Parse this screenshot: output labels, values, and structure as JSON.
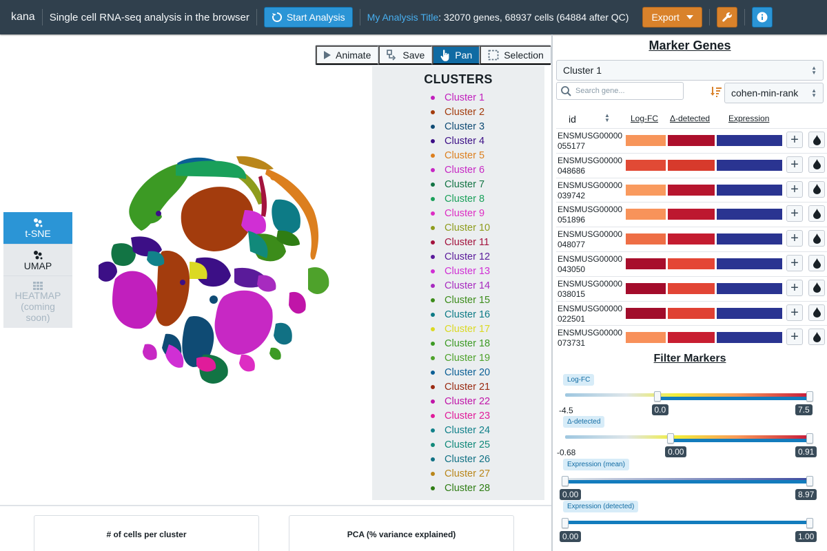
{
  "app": {
    "brand": "kana",
    "subtitle": "Single cell RNA-seq analysis in the browser",
    "start_button": "Start Analysis",
    "analysis_title": "My Analysis Title",
    "analysis_stats": ": 32070 genes, 68937 cells (64884 after QC)",
    "export_button": "Export",
    "colors": {
      "navbar": "#30404d",
      "primary": "#2b95d6",
      "warning": "#d9822b"
    }
  },
  "toolbar": {
    "animate": "Animate",
    "save": "Save",
    "pan": "Pan",
    "selection": "Selection",
    "active": "Pan"
  },
  "sidetabs": {
    "tsne": "t-SNE",
    "umap": "UMAP",
    "heatmap": "HEATMAP",
    "heatmap_note": "(coming soon)"
  },
  "legend": {
    "title": "CLUSTERS",
    "items": [
      {
        "label": "Cluster 1",
        "color": "#c11fbd"
      },
      {
        "label": "Cluster 2",
        "color": "#a33c0d"
      },
      {
        "label": "Cluster 3",
        "color": "#0f4b74"
      },
      {
        "label": "Cluster 4",
        "color": "#3c0f86"
      },
      {
        "label": "Cluster 5",
        "color": "#dc7f1e"
      },
      {
        "label": "Cluster 6",
        "color": "#c728c4"
      },
      {
        "label": "Cluster 7",
        "color": "#127444"
      },
      {
        "label": "Cluster 8",
        "color": "#1aa05a"
      },
      {
        "label": "Cluster 9",
        "color": "#dd2dc3"
      },
      {
        "label": "Cluster 10",
        "color": "#8e9c1d"
      },
      {
        "label": "Cluster 11",
        "color": "#a3133d"
      },
      {
        "label": "Cluster 12",
        "color": "#5a1b9a"
      },
      {
        "label": "Cluster 13",
        "color": "#d02fd4"
      },
      {
        "label": "Cluster 14",
        "color": "#a72bbf"
      },
      {
        "label": "Cluster 15",
        "color": "#3c8c1a"
      },
      {
        "label": "Cluster 16",
        "color": "#0d7b86"
      },
      {
        "label": "Cluster 17",
        "color": "#dbd923"
      },
      {
        "label": "Cluster 18",
        "color": "#3c9a24"
      },
      {
        "label": "Cluster 19",
        "color": "#4ea22b"
      },
      {
        "label": "Cluster 20",
        "color": "#0b5f95"
      },
      {
        "label": "Cluster 21",
        "color": "#9a2b12"
      },
      {
        "label": "Cluster 22",
        "color": "#c015a8"
      },
      {
        "label": "Cluster 23",
        "color": "#e01c9a"
      },
      {
        "label": "Cluster 24",
        "color": "#12818a"
      },
      {
        "label": "Cluster 25",
        "color": "#11897a"
      },
      {
        "label": "Cluster 26",
        "color": "#117184"
      },
      {
        "label": "Cluster 27",
        "color": "#b9861a"
      },
      {
        "label": "Cluster 28",
        "color": "#2f7d14"
      }
    ]
  },
  "bottom": {
    "cells_per_cluster": "# of cells per cluster",
    "pca": "PCA (% variance explained)"
  },
  "markers": {
    "title": "Marker Genes",
    "cluster_select": "Cluster 1",
    "search_placeholder": "Search gene...",
    "rank_select": "cohen-min-rank",
    "columns": {
      "id": "id",
      "logfc": "Log-FC",
      "detected": "Δ-detected",
      "expression": "Expression"
    },
    "rows": [
      {
        "id": "ENSMUSG00000055177",
        "logfc_color": "#f7955a",
        "det_color": "#ac0f2b"
      },
      {
        "id": "ENSMUSG00000048686",
        "logfc_color": "#e14a35",
        "det_color": "#d73a2c"
      },
      {
        "id": "ENSMUSG00000039742",
        "logfc_color": "#f99a5e",
        "det_color": "#b7152e"
      },
      {
        "id": "ENSMUSG00000051896",
        "logfc_color": "#f8935a",
        "det_color": "#bd182f"
      },
      {
        "id": "ENSMUSG00000048077",
        "logfc_color": "#ee6e45",
        "det_color": "#c41c30"
      },
      {
        "id": "ENSMUSG00000043050",
        "logfc_color": "#a80e2c",
        "det_color": "#e44635"
      },
      {
        "id": "ENSMUSG00000038015",
        "logfc_color": "#a30c2b",
        "det_color": "#e24535"
      },
      {
        "id": "ENSMUSG00000022501",
        "logfc_color": "#a10d2b",
        "det_color": "#e04133"
      },
      {
        "id": "ENSMUSG00000073731",
        "logfc_color": "#f8905a",
        "det_color": "#c81e31"
      }
    ],
    "expression_color": "#2a3491"
  },
  "filters": {
    "title": "Filter Markers",
    "logfc": {
      "label": "Log-FC",
      "min": "-4.5",
      "low": "0.0",
      "high": "7.5",
      "low_frac": 0.375,
      "high_frac": 1.0
    },
    "detected": {
      "label": "Δ-detected",
      "min": "-0.68",
      "low": "0.00",
      "high": "0.91",
      "low_frac": 0.43,
      "high_frac": 1.0
    },
    "expression_mean": {
      "label": "Expression (mean)",
      "low": "0.00",
      "high": "8.97",
      "low_frac": 0.0,
      "high_frac": 1.0
    },
    "expression_detected": {
      "label": "Expression (detected)",
      "low": "0.00",
      "high": "1.00",
      "low_frac": 0.0,
      "high_frac": 1.0
    }
  }
}
